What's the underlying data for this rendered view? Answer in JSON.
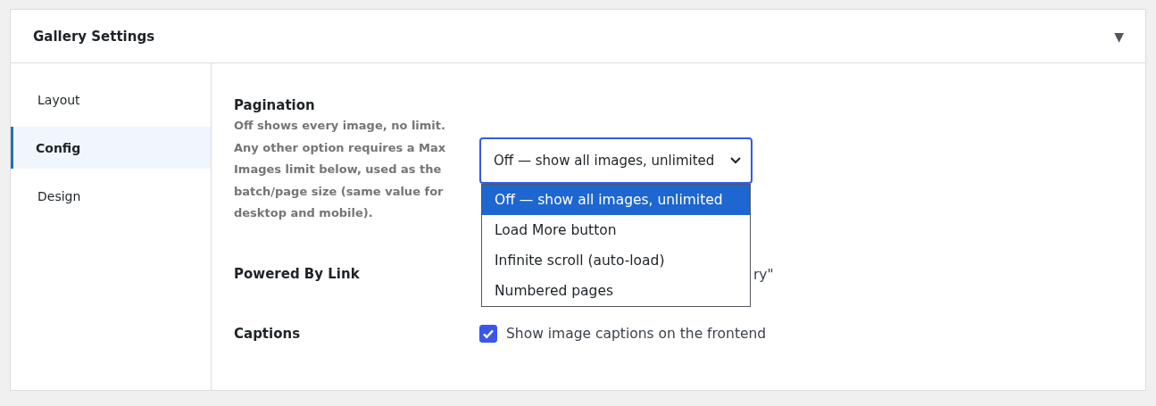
{
  "panel": {
    "title": "Gallery Settings",
    "collapse_icon": "▼"
  },
  "sidebar": {
    "items": [
      {
        "label": "Layout",
        "selected": false
      },
      {
        "label": "Config",
        "selected": true
      },
      {
        "label": "Design",
        "selected": false
      }
    ]
  },
  "settings": [
    {
      "kind": "select",
      "label": "Pagination",
      "description": "Off shows every image, no limit. Any other option requires a Max Images limit below, used as the batch/page size (same value for desktop and mobile).",
      "value": "Off — show all images, unlimited",
      "expanded": true,
      "options": [
        {
          "label": "Off — show all images, unlimited",
          "selected": true
        },
        {
          "label": "Load More button",
          "selected": false
        },
        {
          "label": "Infinite scroll (auto-load)",
          "selected": false
        },
        {
          "label": "Numbered pages",
          "selected": false
        }
      ]
    },
    {
      "kind": "covered",
      "label": "Powered By Link",
      "text": "ry\""
    },
    {
      "kind": "checkbox",
      "label": "Captions",
      "text": "Show image captions on the frontend",
      "checked": true
    }
  ]
}
